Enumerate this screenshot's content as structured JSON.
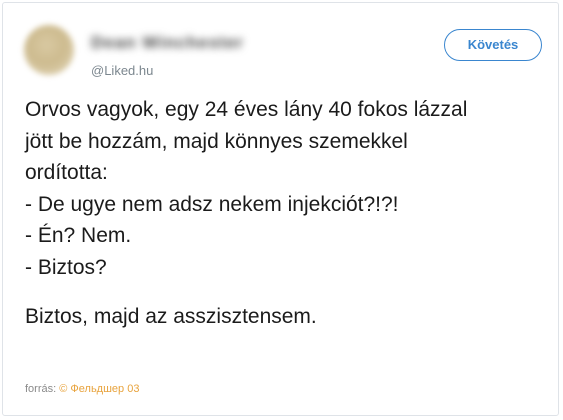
{
  "profile": {
    "display_name": "Dean Winchester",
    "handle": "@Liked.hu"
  },
  "follow_button": {
    "label": "Követés"
  },
  "tweet": {
    "lines": [
      "Orvos vagyok, egy 24 éves lány 40 fokos lázzal",
      "jött be hozzám, majd könnyes szemekkel",
      "ordította:",
      "- De ugye nem adsz nekem injekciót?!?!",
      "- Én? Nem.",
      "- Biztos?"
    ],
    "closing": "Biztos, majd az asszisztensem."
  },
  "source": {
    "label": "forrás:",
    "link_text": "© Фельдшер 03",
    "link_color": "#e8a33d"
  },
  "colors": {
    "accent": "#3a86cf",
    "text": "#1b1b1b",
    "muted": "#7c878f",
    "border": "#dfe3e8"
  }
}
